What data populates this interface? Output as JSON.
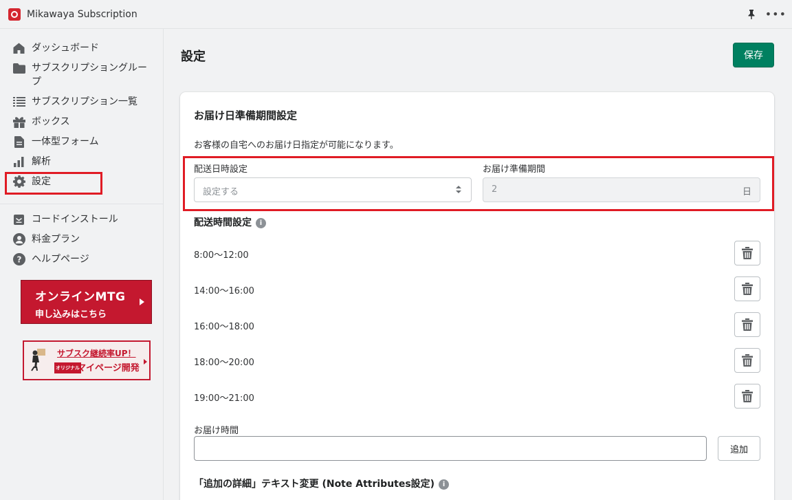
{
  "app": {
    "title": "Mikawaya Subscription"
  },
  "sidebar": {
    "items": [
      {
        "label": "ダッシュボード",
        "icon": "home-icon"
      },
      {
        "label": "サブスクリプショングループ",
        "icon": "folder-icon"
      },
      {
        "label": "サブスクリプション一覧",
        "icon": "list-icon"
      },
      {
        "label": "ボックス",
        "icon": "gift-icon"
      },
      {
        "label": "一体型フォーム",
        "icon": "document-icon"
      },
      {
        "label": "解析",
        "icon": "bar-chart-icon"
      },
      {
        "label": "設定",
        "icon": "gear-icon",
        "selected": true
      },
      {
        "label": "コードインストール",
        "icon": "download-icon"
      },
      {
        "label": "料金プラン",
        "icon": "user-icon"
      },
      {
        "label": "ヘルプページ",
        "icon": "question-icon"
      }
    ],
    "banner_mtg": {
      "line1": "オンラインMTG",
      "line2": "申し込みはこちら"
    },
    "banner_mypage": {
      "line1": "サブスク継続率UP！",
      "tag": "オリジナル",
      "line2": "マイページ開発"
    }
  },
  "main": {
    "title": "設定",
    "save_label": "保存",
    "delivery_prep": {
      "title": "お届け日準備期間設定",
      "description": "お客様の自宅へのお届け日指定が可能になります。",
      "date_label": "配送日時設定",
      "date_value": "設定する",
      "prep_label": "お届け準備期間",
      "prep_value": "2",
      "prep_unit": "日"
    },
    "delivery_time": {
      "title": "配送時間設定",
      "slots": [
        "8:00〜12:00",
        "14:00〜16:00",
        "16:00〜18:00",
        "18:00〜20:00",
        "19:00〜21:00"
      ],
      "input_label": "お届け時間",
      "input_value": "",
      "add_label": "追加"
    },
    "note_attributes": {
      "title": "「追加の詳細」テキスト変更 (Note Attributes設定)"
    }
  },
  "colors": {
    "primary": "#008060",
    "highlight": "#e01b24",
    "brand": "#c4182f"
  }
}
